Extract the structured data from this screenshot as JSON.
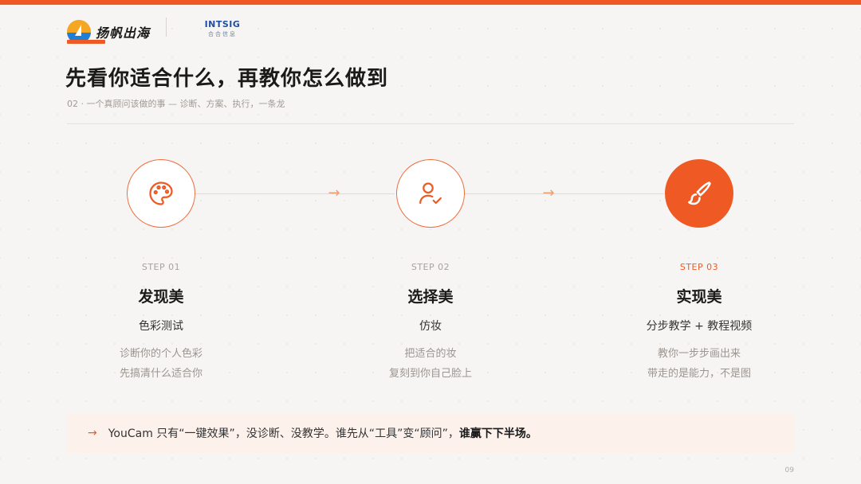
{
  "header": {
    "brand_name": "扬帆出海",
    "partner_name": "INTSIG",
    "partner_sub": "合合信息"
  },
  "title": "先看你适合什么，再教你怎么做到",
  "subtitle": "02 · 一个真顾问该做的事 — 诊断、方案、执行，一条龙",
  "steps": [
    {
      "no": "STEP 01",
      "title": "发现美",
      "method": "色彩测试",
      "desc1": "诊断你的个人色彩",
      "desc2": "先搞清什么适合你",
      "icon": "palette-icon",
      "active": false
    },
    {
      "no": "STEP 02",
      "title": "选择美",
      "method": "仿妆",
      "desc1": "把适合的妆",
      "desc2": "复刻到你自己脸上",
      "icon": "user-check-icon",
      "active": false
    },
    {
      "no": "STEP 03",
      "title": "实现美",
      "method": "分步教学 + 教程视频",
      "desc1": "教你一步步画出来",
      "desc2": "带走的是能力，不是图",
      "icon": "brush-icon",
      "active": true
    }
  ],
  "arrows": [
    "→",
    "→"
  ],
  "note": {
    "arrow": "→",
    "text": "YouCam 只有“一键效果”，没诊断、没教学。谁先从“工具”变“顾问”，",
    "strong": "谁赢下下半场。"
  },
  "page_number": "09",
  "colors": {
    "accent": "#ef5a24",
    "note_bg": "#fdf1ec",
    "brand_blue": "#1e4fa3"
  }
}
